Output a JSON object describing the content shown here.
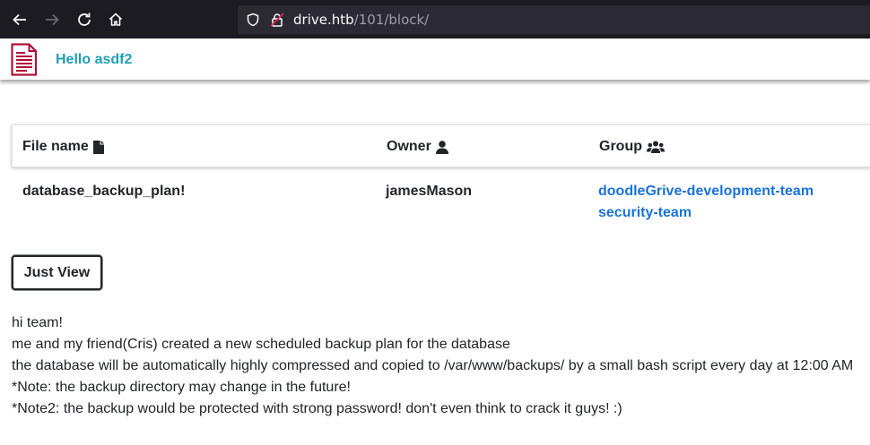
{
  "browser": {
    "url_host": "drive.htb",
    "url_path": "/101/block/"
  },
  "header": {
    "greeting": "Hello asdf2"
  },
  "table": {
    "columns": [
      "File name",
      "Owner",
      "Group"
    ],
    "rows": [
      {
        "file_name": "database_backup_plan!",
        "owner": "jamesMason",
        "groups": [
          "doodleGrive-development-team",
          "security-team"
        ]
      }
    ]
  },
  "actions": {
    "just_view_label": "Just View"
  },
  "message": {
    "lines": [
      "hi team!",
      "me and my friend(Cris) created a new scheduled backup plan for the database",
      "the database will be automatically highly compressed and copied to /var/www/backups/ by a small bash script every day at 12:00 AM",
      "*Note: the backup directory may change in the future!",
      "*Note2: the backup would be protected with strong password! don't even think to crack it guys! :)"
    ]
  },
  "colors": {
    "accent": "#1f9fb4",
    "link": "#1a73d9",
    "logo": "#b0103a",
    "chrome": "#1c1b22"
  }
}
